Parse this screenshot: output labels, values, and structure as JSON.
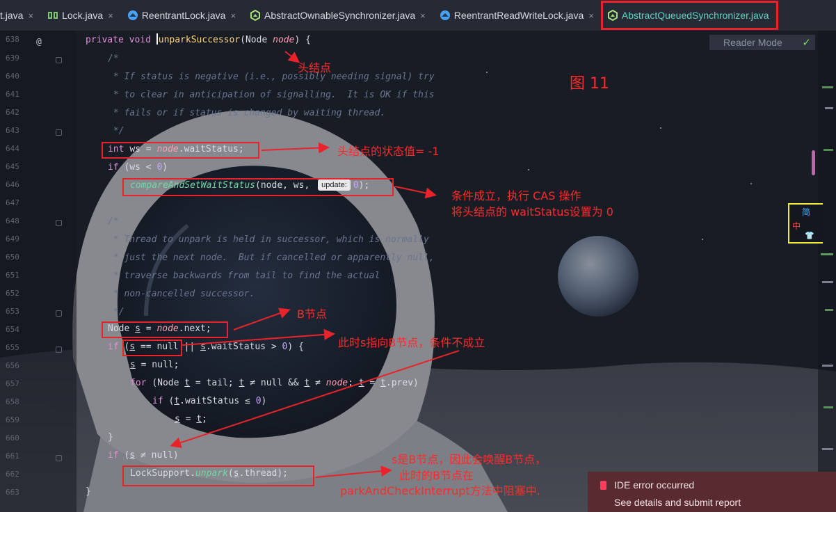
{
  "tabs": [
    {
      "label": "t.java",
      "icon": "java-file-icon"
    },
    {
      "label": "Lock.java",
      "icon": "interface-icon"
    },
    {
      "label": "ReentrantLock.java",
      "icon": "class-icon"
    },
    {
      "label": "AbstractOwnableSynchronizer.java",
      "icon": "abstract-class-icon"
    },
    {
      "label": "ReentrantReadWriteLock.java",
      "icon": "class-icon"
    },
    {
      "label": "AbstractQueuedSynchronizer.java",
      "icon": "abstract-class-icon",
      "active": true
    }
  ],
  "tab_close": "×",
  "gutter": {
    "line_numbers": [
      "638",
      "639",
      "640",
      "641",
      "642",
      "643",
      "644",
      "645",
      "646",
      "647",
      "648",
      "649",
      "650",
      "651",
      "652",
      "653",
      "654",
      "655",
      "656",
      "657",
      "658",
      "659",
      "660",
      "661",
      "662",
      "663"
    ],
    "override_marker": "@"
  },
  "code": {
    "l638_kw": "private void ",
    "l638_fn": "unparkSuccessor",
    "l638_a": "(Node ",
    "l638_b": "node",
    "l638_c": ") {",
    "l639": "/*",
    "l640": " * If status is negative (i.e., possibly needing signal) try",
    "l641": " * to clear in anticipation of signalling.  It is OK if this",
    "l642": " * fails or if status is changed by waiting thread.",
    "l643": " */",
    "l644_kw": "int ",
    "l644_a": "ws = ",
    "l644_b": "node",
    "l644_c": ".waitStatus;",
    "l645_kw": "if ",
    "l645_a": "(ws < ",
    "l645_n": "0",
    "l645_b": ")",
    "l646_fn": "compareAndSetWaitStatus",
    "l646_a": "(node, ws, ",
    "l646_hint": "update:",
    "l646_n": "0",
    "l646_b": ");",
    "l648": "/*",
    "l649": " * Thread to unpark is held in successor, which is normally",
    "l650": " * just the next node.  But if cancelled or apparently null,",
    "l651": " * traverse backwards from tail to find the actual",
    "l652": " * non-cancelled successor.",
    "l653": " */",
    "l654_a": "Node ",
    "l654_s": "s",
    "l654_b": " = ",
    "l654_c": "node",
    "l654_d": ".next;",
    "l655_kw": "if ",
    "l655_a": "(",
    "l655_s": "s",
    "l655_b": " == null",
    "l655_c": " || ",
    "l655_s2": "s",
    "l655_d": ".waitStatus > ",
    "l655_n": "0",
    "l655_e": ") {",
    "l656_s": "s",
    "l656_a": " = null;",
    "l657_kw": "for ",
    "l657_a": "(Node ",
    "l657_t": "t",
    "l657_b": " = tail; ",
    "l657_t2": "t",
    "l657_c": " ≠ null && ",
    "l657_t3": "t",
    "l657_d": " ≠ ",
    "l657_e": "node",
    "l657_f": "; ",
    "l657_t4": "t",
    "l657_g": " = ",
    "l657_t5": "t",
    "l657_h": ".prev)",
    "l658_kw": "if ",
    "l658_a": "(",
    "l658_t": "t",
    "l658_b": ".waitStatus ≤ ",
    "l658_n": "0",
    "l658_c": ")",
    "l659_s": "s",
    "l659_a": " = ",
    "l659_t": "t",
    "l659_b": ";",
    "l660": "}",
    "l661_kw": "if ",
    "l661_a": "(",
    "l661_s": "s",
    "l661_b": " ≠ null)",
    "l662_a": "LockSupport.",
    "l662_fn": "unpark",
    "l662_b": "(",
    "l662_s": "s",
    "l662_c": ".thread);",
    "l663": "}"
  },
  "reader_mode": {
    "label": "Reader Mode",
    "check": "✓"
  },
  "annotations": {
    "figure_label": "图 11",
    "head_node": "头结点",
    "head_status": "头结点的状态值= -1",
    "cas_1": "条件成立，执行 CAS 操作",
    "cas_2": "将头结点的 waitStatus设置为 0",
    "b_node": "B节点",
    "s_points_b": "此时s指向B节点，条件不成立",
    "wake_1": "s是B节点，因此会唤醒B节点，",
    "wake_2": "此时的B节点在",
    "wake_3": "parkAndCheckInterrupt方法中阻塞中."
  },
  "ime": {
    "simplified": "简",
    "chinese": "中",
    "shirt": "👕"
  },
  "error_toast": {
    "title": "IDE error occurred",
    "link": "See details and submit report"
  },
  "colors": {
    "annotation_red": "#e8242a",
    "active_tab_text": "#5fd3c2",
    "toast_bg": "#5a2a31"
  }
}
